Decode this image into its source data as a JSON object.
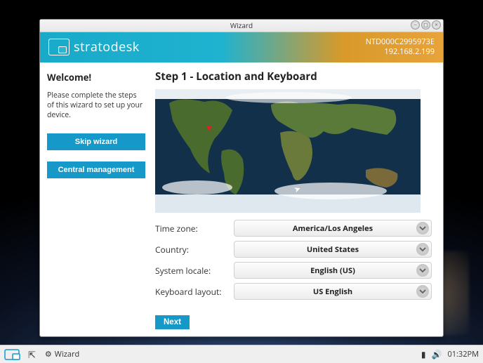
{
  "window": {
    "title": "Wizard"
  },
  "banner": {
    "brand": "stratodesk",
    "device_id": "NTD000C2995973E",
    "ip": "192.168.2.199"
  },
  "sidebar": {
    "welcome": "Welcome!",
    "instruction": "Please complete the steps of this wizard to set up your device.",
    "skip_label": "Skip wizard",
    "central_label": "Central management"
  },
  "main": {
    "step_title": "Step 1 - Location and Keyboard",
    "fields": {
      "timezone_label": "Time zone:",
      "timezone_value": "America/Los Angeles",
      "country_label": "Country:",
      "country_value": "United States",
      "locale_label": "System locale:",
      "locale_value": "English (US)",
      "keyboard_label": "Keyboard layout:",
      "keyboard_value": "US English"
    },
    "next_label": "Next"
  },
  "taskbar": {
    "app_label": "Wizard",
    "clock": "01:32PM"
  }
}
